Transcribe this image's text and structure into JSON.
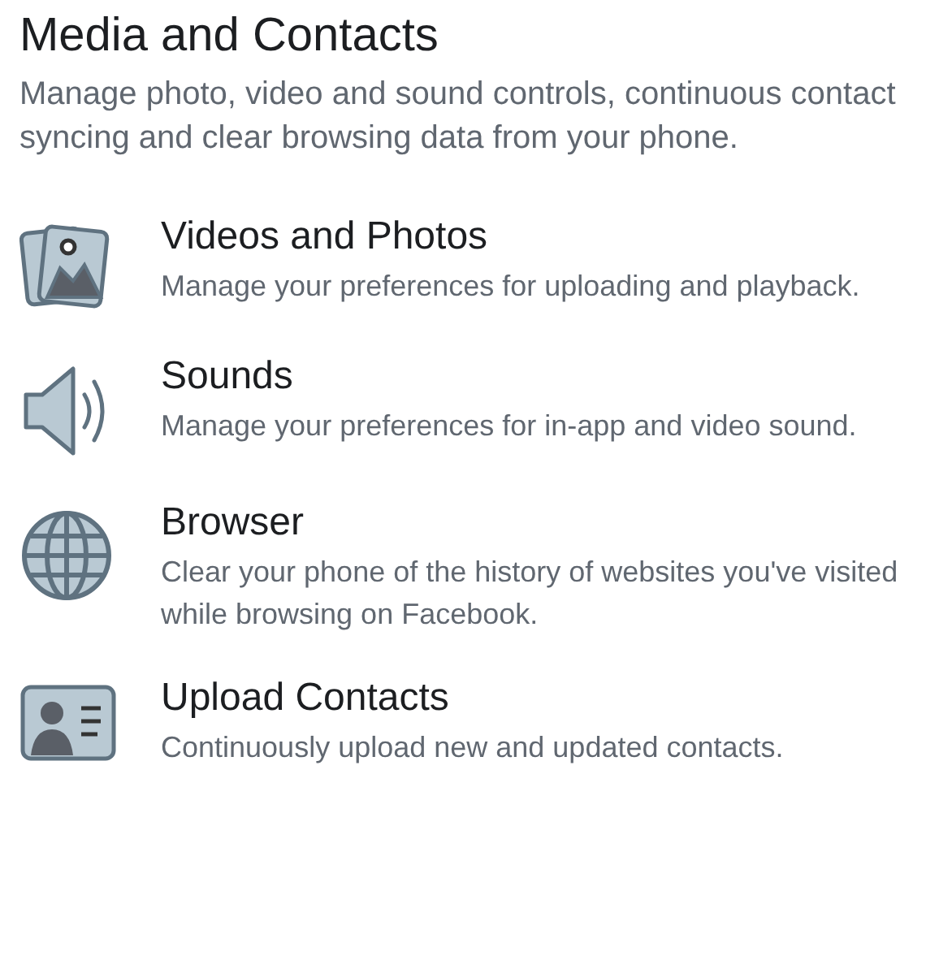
{
  "header": {
    "title": "Media and Contacts",
    "description": "Manage photo, video and sound controls, continuous contact syncing and clear browsing data from your phone."
  },
  "items": [
    {
      "kind": "photos",
      "title": "Videos and Photos",
      "description": "Manage your preferences for uploading and playback."
    },
    {
      "kind": "sound",
      "title": "Sounds",
      "description": "Manage your preferences for in-app and video sound."
    },
    {
      "kind": "globe",
      "title": "Browser",
      "description": "Clear your phone of the history of websites you've visited while browsing on Facebook."
    },
    {
      "kind": "contact",
      "title": "Upload Contacts",
      "description": "Continuously upload new and updated contacts."
    }
  ]
}
